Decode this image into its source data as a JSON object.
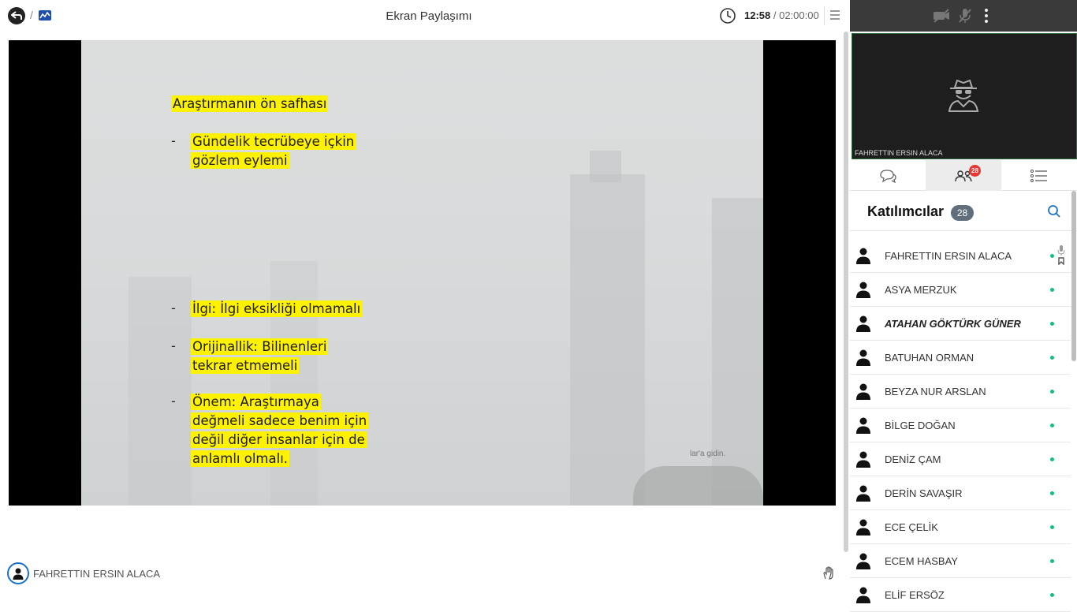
{
  "header": {
    "separator": "/",
    "title": "Ekran Paylaşımı",
    "time_current": "12:58",
    "time_separator": " / ",
    "time_total": "02:00:00"
  },
  "slide": {
    "heading": "Araştırmanın ön safhası",
    "bullet_dash": "-",
    "bullet1_line1": "Gündelik tecrübeye içkin",
    "bullet1_line2": "gözlem eylemi",
    "bullet2_line1": "İlgi: İlgi eksikliği olmamalı",
    "bullet3_line1": "Orijinallik: Bilinenleri",
    "bullet3_line2": "tekrar etmemeli",
    "bullet4_line1": "Önem: Araştırmaya",
    "bullet4_line2": "değmeli sadece benim için",
    "bullet4_line3": "değil diğer insanlar için de",
    "bullet4_line4": "anlamlı olmalı.",
    "hint": "lar'a gidin."
  },
  "presenter": {
    "name": "FAHRETTIN ERSIN ALACA"
  },
  "video": {
    "name": "FAHRETTIN ERSIN ALACA"
  },
  "tabs": {
    "participants_badge": "28"
  },
  "participants": {
    "title": "Katılımcılar",
    "count": "28",
    "list": [
      {
        "name": "FAHRETTIN ERSIN ALACA"
      },
      {
        "name": "ASYA MERZUK"
      },
      {
        "name": "ATAHAN GÖKTÜRK GÜNER"
      },
      {
        "name": "BATUHAN ORMAN"
      },
      {
        "name": "BEYZA NUR ARSLAN"
      },
      {
        "name": "BİLGE DOĞAN"
      },
      {
        "name": "DENİZ ÇAM"
      },
      {
        "name": "DERİN SAVAŞIR"
      },
      {
        "name": "ECE ÇELİK"
      },
      {
        "name": "ECEM HASBAY"
      },
      {
        "name": "ELİF ERSÖZ"
      }
    ]
  },
  "colors": {
    "accent": "#1a73c9",
    "online": "#1abc7b",
    "badge": "#e53935",
    "highlight": "#fff200"
  },
  "icons": [
    "back-icon",
    "app-logo-icon",
    "clock-icon",
    "menu-icon",
    "camera-off-icon",
    "mic-off-icon",
    "more-vertical-icon",
    "spy-avatar-icon",
    "chat-icon",
    "participants-icon",
    "list-icon",
    "search-icon",
    "user-icon",
    "raise-hand-icon"
  ]
}
